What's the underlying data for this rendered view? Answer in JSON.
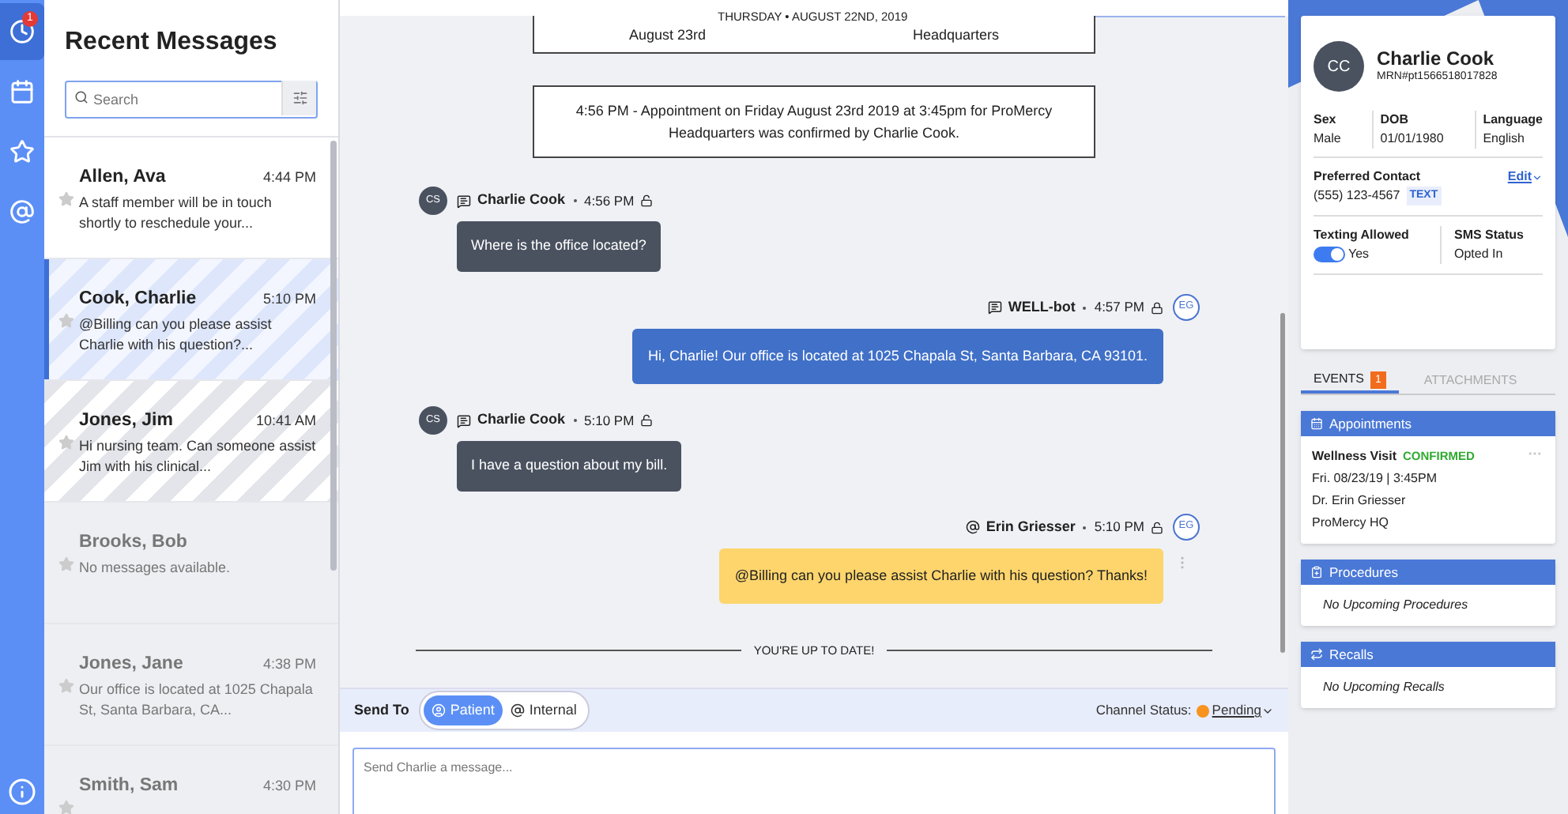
{
  "rail": {
    "items": [
      {
        "kind": "clock",
        "selected": true,
        "badge": "1"
      },
      {
        "kind": "calendar",
        "selected": false
      },
      {
        "kind": "star",
        "selected": false
      },
      {
        "kind": "at",
        "selected": false
      }
    ],
    "info": true
  },
  "sidebar": {
    "title": "Recent Messages",
    "search": {
      "placeholder": "Search"
    },
    "conversations": [
      {
        "name": "Allen, Ava",
        "time": "4:44 PM",
        "preview": "A staff member will be in touch shortly to reschedule your...",
        "kind": "read",
        "selected": false
      },
      {
        "name": "Cook, Charlie",
        "time": "5:10 PM",
        "preview": "@Billing can you please assist Charlie with his question?...",
        "kind": "assigned",
        "selected": true
      },
      {
        "name": "Jones, Jim",
        "time": "10:41 AM",
        "preview": "Hi nursing team. Can someone assist Jim with his clinical...",
        "kind": "waiting",
        "selected": false
      },
      {
        "name": "Brooks, Bob",
        "preview": "No messages available.",
        "kind": "inactive",
        "selected": false
      },
      {
        "name": "Jones, Jane",
        "time": "4:38 PM",
        "preview": "Our office is located at 1025 Chapala St, Santa Barbara, CA...",
        "kind": "inactive",
        "selected": false
      },
      {
        "name": "Smith, Sam",
        "time": "4:30 PM",
        "kind": "inactive",
        "selected": false
      }
    ]
  },
  "chat": {
    "date_divider": "THURSDAY • AUGUST 22ND, 2019",
    "partial_event": {
      "left": "August 23rd",
      "right": "Headquarters"
    },
    "events": [
      "4:56 PM - Appointment on Friday August 23rd 2019 at 3:45pm for ProMercy Headquarters was confirmed by Charlie Cook."
    ],
    "messages": [
      {
        "kind": "patient",
        "initials": "CS",
        "sender": "Charlie Cook",
        "time": "4:56 PM",
        "text": "Where is the office located?"
      },
      {
        "kind": "staff",
        "initials": "EG",
        "sender": "WELL-bot",
        "time": "4:57 PM",
        "text": "Hi, Charlie! Our office is located at 1025 Chapala St, Santa Barbara, CA 93101."
      },
      {
        "kind": "patient",
        "initials": "CS",
        "sender": "Charlie Cook",
        "time": "5:10 PM",
        "text": "I have a question about my bill."
      },
      {
        "kind": "internal",
        "initials": "EG",
        "sender": "Erin Griesser",
        "time": "5:10 PM",
        "text": "@Billing can you please assist Charlie with his question? Thanks!"
      }
    ],
    "up_to_date": "YOU'RE UP TO DATE!"
  },
  "composer": {
    "send_to_label": "Send To",
    "recipients": [
      {
        "label": "Patient",
        "kind": "patient",
        "selected": true
      },
      {
        "label": "Internal",
        "kind": "internal",
        "selected": false
      }
    ],
    "channel_status_label": "Channel Status:",
    "channel_status": {
      "value": "Pending",
      "color": "#f7931e"
    },
    "placeholder": "Send Charlie a message..."
  },
  "patient": {
    "initials": "CC",
    "name": "Charlie Cook",
    "mrn": "MRN#pt1566518017828",
    "fields": [
      {
        "label": "Sex",
        "value": "Male"
      },
      {
        "label": "DOB",
        "value": "01/01/1980"
      },
      {
        "label": "Language",
        "value": "English"
      }
    ],
    "preferred_contact": {
      "label": "Preferred Contact",
      "edit": "Edit",
      "phone": "(555) 123-4567",
      "type": "TEXT"
    },
    "texting": {
      "label": "Texting Allowed",
      "on": true,
      "value": "Yes"
    },
    "sms": {
      "label": "SMS Status",
      "value": "Opted In"
    }
  },
  "tabs": [
    {
      "label": "EVENTS",
      "badge": "1",
      "selected": true
    },
    {
      "label": "ATTACHMENTS",
      "selected": false
    }
  ],
  "sections": [
    {
      "kind": "calendar",
      "title": "Appointments",
      "items": [
        {
          "title": "Wellness Visit",
          "status": "CONFIRMED",
          "lines": [
            "Fri. 08/23/19 | 3:45PM",
            "Dr. Erin Griesser",
            "ProMercy HQ"
          ]
        }
      ]
    },
    {
      "kind": "clipboard",
      "title": "Procedures",
      "empty": "No Upcoming Procedures"
    },
    {
      "kind": "repeat",
      "title": "Recalls",
      "empty": "No Upcoming Recalls"
    }
  ]
}
